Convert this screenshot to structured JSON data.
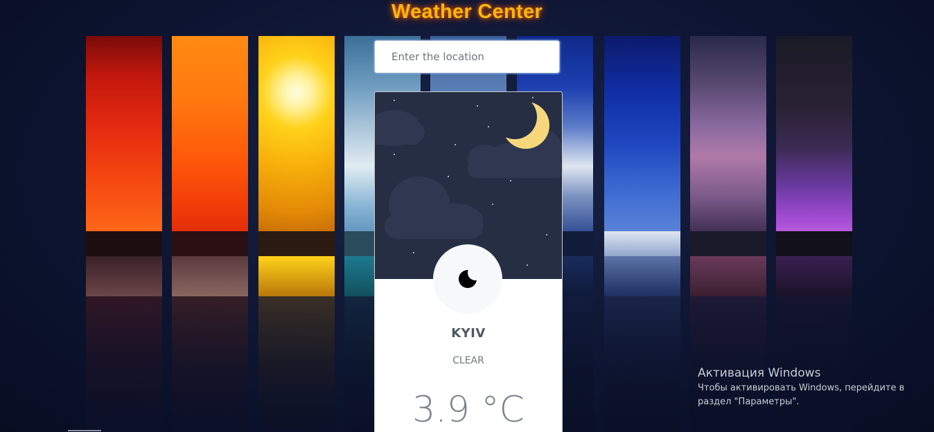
{
  "app": {
    "title": "Weather Center"
  },
  "search": {
    "placeholder": "Enter the location",
    "value": ""
  },
  "weather": {
    "city": "KYIV",
    "condition": "CLEAR",
    "temperature": "3.9 °C",
    "scene": "night-clear",
    "icon": "moon-icon"
  },
  "system_overlay": {
    "title": "Активация Windows",
    "text_line1": "Чтобы активировать Windows, перейдите в",
    "text_line2": "раздел \"Параметры\"."
  },
  "colors": {
    "title": "#f5b70f",
    "card_sky": "#262e44",
    "moon": "#f7d77b",
    "background": "#0c1430"
  }
}
